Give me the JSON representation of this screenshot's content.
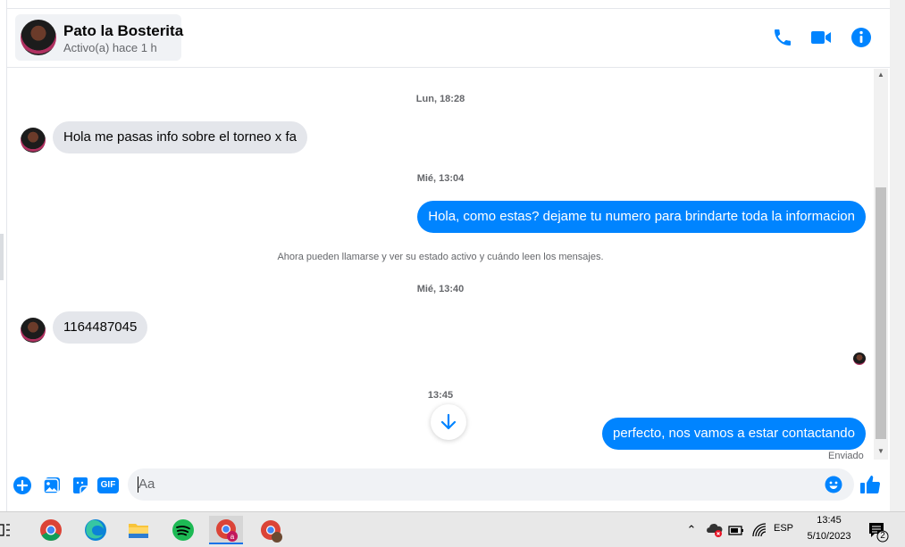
{
  "header": {
    "contact_name": "Pato la Bosterita",
    "contact_status": "Activo(a) hace 1 h",
    "icons": [
      "phone-icon",
      "video-call-icon",
      "info-icon"
    ]
  },
  "messages": {
    "ts1": "Lun, 18:28",
    "msg1": "Hola  me pasas info sobre el torneo x fa",
    "ts2": "Mié, 13:04",
    "msg2": "Hola, como estas? dejame tu numero para brindarte toda la informacion",
    "system_note": "Ahora pueden llamarse y ver su estado activo y cuándo leen los mensajes.",
    "ts3": "Mié, 13:40",
    "msg3": "1164487045",
    "ts4": "13:45",
    "msg4": "perfecto, nos vamos a estar contactando",
    "sent_status": "Enviado"
  },
  "composer": {
    "placeholder": "Aa",
    "icons": [
      "add-icon",
      "image-icon",
      "sticker-icon",
      "gif-icon",
      "emoji-icon",
      "like-icon"
    ],
    "gif_label": "GIF"
  },
  "taskbar": {
    "apps": [
      "task-view-icon",
      "chrome-icon",
      "edge-icon",
      "file-explorer-icon",
      "spotify-icon",
      "chrome-profile-icon",
      "chrome-profile2-icon"
    ],
    "language": "ESP",
    "time": "13:45",
    "date": "5/10/2023",
    "notification_count": "2"
  },
  "colors": {
    "accent": "#0084ff",
    "incoming_bubble": "#e4e6eb",
    "muted_text": "#65676b"
  }
}
